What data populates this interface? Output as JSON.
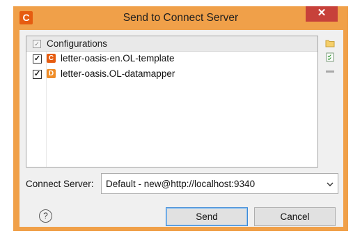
{
  "window": {
    "title": "Send to Connect Server",
    "app_icon_letter": "C",
    "close_glyph": "✕",
    "frame_color": "#f0a049",
    "close_color": "#c7413a"
  },
  "list": {
    "header_label": "Configurations",
    "header_checked": true,
    "items": [
      {
        "label": "letter-oasis-en.OL-template",
        "checked": true,
        "icon": "template-file-icon",
        "icon_glyph": "C",
        "icon_color": "#e65c10"
      },
      {
        "label": "letter-oasis.OL-datamapper",
        "checked": true,
        "icon": "datamapper-file-icon",
        "icon_glyph": "D",
        "icon_color": "#ef8d28"
      }
    ]
  },
  "side_tools": [
    "folder-icon",
    "checklist-icon",
    "remove-icon"
  ],
  "connect_server": {
    "label": "Connect Server:",
    "value": "Default - new@http://localhost:9340"
  },
  "buttons": {
    "help_glyph": "?",
    "send": "Send",
    "cancel": "Cancel"
  }
}
